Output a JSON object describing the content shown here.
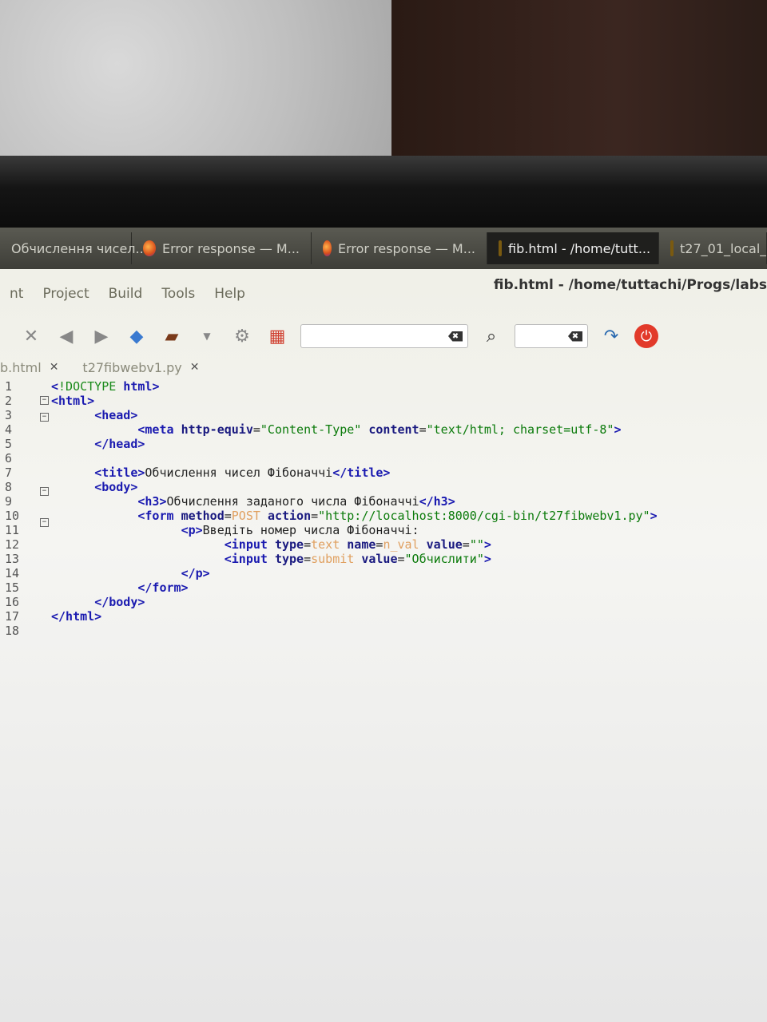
{
  "taskbar": {
    "tasks": [
      {
        "label": "Обчислення чисел...",
        "icon": "firefox-icon"
      },
      {
        "label": "Error response — M...",
        "icon": "firefox-icon"
      },
      {
        "label": "Error response — M...",
        "icon": "firefox-icon"
      },
      {
        "label": "fib.html - /home/tutt...",
        "icon": "geany-icon"
      },
      {
        "label": "t27_01_local_",
        "icon": "geany-icon"
      }
    ]
  },
  "window": {
    "title": "fib.html - /home/tuttachi/Progs/labs"
  },
  "menu": {
    "items": [
      "nt",
      "Project",
      "Build",
      "Tools",
      "Help"
    ]
  },
  "toolbar": {
    "clear_icon": "✖",
    "power_icon": "⏻"
  },
  "tabs": [
    {
      "label": "b.html"
    },
    {
      "label": "t27fibwebv1.py"
    }
  ],
  "editor": {
    "line_numbers": [
      "1",
      "2",
      "3",
      "4",
      "5",
      "6",
      "7",
      "8",
      "9",
      "10",
      "11",
      "12",
      "13",
      "14",
      "15",
      "16",
      "17",
      "18"
    ],
    "lines": [
      {
        "indent": "",
        "parts": [
          [
            "t",
            "<"
          ],
          [
            "d",
            "!DOCTYPE"
          ],
          [
            "t",
            " html"
          ],
          [
            "t",
            ">"
          ]
        ]
      },
      {
        "indent": "",
        "parts": [
          [
            "t",
            "<html>"
          ]
        ]
      },
      {
        "indent": "      ",
        "parts": [
          [
            "t",
            "<head>"
          ]
        ]
      },
      {
        "indent": "            ",
        "parts": [
          [
            "t",
            "<meta "
          ],
          [
            "a",
            "http-equiv"
          ],
          [
            "x",
            "="
          ],
          [
            "s",
            "\"Content-Type\""
          ],
          [
            "x",
            " "
          ],
          [
            "a",
            "content"
          ],
          [
            "x",
            "="
          ],
          [
            "s",
            "\"text/html; charset=utf-8\""
          ],
          [
            "t",
            ">"
          ]
        ]
      },
      {
        "indent": "      ",
        "parts": [
          [
            "t",
            "</head>"
          ]
        ]
      },
      {
        "indent": "",
        "parts": []
      },
      {
        "indent": "      ",
        "parts": [
          [
            "t",
            "<title>"
          ],
          [
            "x",
            "Обчислення чисел Фібоначчі"
          ],
          [
            "t",
            "</title>"
          ]
        ]
      },
      {
        "indent": "      ",
        "parts": [
          [
            "t",
            "<body>"
          ]
        ]
      },
      {
        "indent": "            ",
        "parts": [
          [
            "t",
            "<h3>"
          ],
          [
            "x",
            "Обчислення заданого числа Фібоначчі"
          ],
          [
            "t",
            "</h3>"
          ]
        ]
      },
      {
        "indent": "            ",
        "parts": [
          [
            "t",
            "<form "
          ],
          [
            "a",
            "method"
          ],
          [
            "x",
            "="
          ],
          [
            "u",
            "POST"
          ],
          [
            "x",
            " "
          ],
          [
            "a",
            "action"
          ],
          [
            "x",
            "="
          ],
          [
            "s",
            "\"http://localhost:8000/cgi-bin/t27fibwebv1.py\""
          ],
          [
            "t",
            ">"
          ]
        ]
      },
      {
        "indent": "                  ",
        "parts": [
          [
            "t",
            "<p>"
          ],
          [
            "x",
            "Введіть номер числа Фібоначчі:"
          ]
        ]
      },
      {
        "indent": "                        ",
        "parts": [
          [
            "t",
            "<input "
          ],
          [
            "a",
            "type"
          ],
          [
            "x",
            "="
          ],
          [
            "u",
            "text"
          ],
          [
            "x",
            " "
          ],
          [
            "a",
            "name"
          ],
          [
            "x",
            "="
          ],
          [
            "u",
            "n_val"
          ],
          [
            "x",
            " "
          ],
          [
            "a",
            "value"
          ],
          [
            "x",
            "="
          ],
          [
            "s",
            "\"\""
          ],
          [
            "t",
            ">"
          ]
        ]
      },
      {
        "indent": "                        ",
        "parts": [
          [
            "t",
            "<input "
          ],
          [
            "a",
            "type"
          ],
          [
            "x",
            "="
          ],
          [
            "u",
            "submit"
          ],
          [
            "x",
            " "
          ],
          [
            "a",
            "value"
          ],
          [
            "x",
            "="
          ],
          [
            "s",
            "\"Обчислити\""
          ],
          [
            "t",
            ">"
          ]
        ]
      },
      {
        "indent": "                  ",
        "parts": [
          [
            "t",
            "</p>"
          ]
        ]
      },
      {
        "indent": "            ",
        "parts": [
          [
            "t",
            "</form>"
          ]
        ]
      },
      {
        "indent": "      ",
        "parts": [
          [
            "t",
            "</body>"
          ]
        ]
      },
      {
        "indent": "",
        "parts": [
          [
            "t",
            "</html>"
          ]
        ]
      },
      {
        "indent": "",
        "parts": []
      }
    ]
  }
}
